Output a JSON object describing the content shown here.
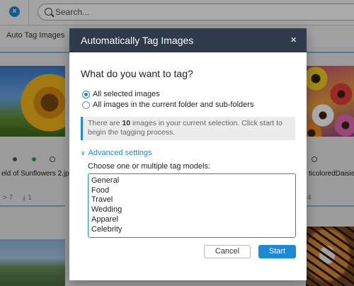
{
  "app": {
    "search_placeholder": "Search...",
    "toolbar_label": "Auto Tag Images",
    "file_left": "eld of Sunflowers 2.jpg",
    "file_right": "ticoloredDaisies",
    "meta_left_views": "7",
    "meta_left_downloads": "1",
    "meta_right_views": "4"
  },
  "dialog": {
    "title": "Automatically Tag Images",
    "close_glyph": "×",
    "question": "What do you want to tag?",
    "options": [
      {
        "label": "All selected images",
        "checked": true
      },
      {
        "label": "All images in the current folder and sub-folders",
        "checked": false
      }
    ],
    "info": {
      "prefix": "There are ",
      "count": "10",
      "suffix": " images in your current selection. Click start to begin the tagging process."
    },
    "advanced_label": "Advanced settings",
    "models_label": "Choose one or multiple tag models:",
    "models": [
      "General",
      "Food",
      "Travel",
      "Wedding",
      "Apparel",
      "Celebrity"
    ],
    "cancel_label": "Cancel",
    "start_label": "Start"
  },
  "colors": {
    "accent": "#1e88d6",
    "header": "#2f3a4b"
  },
  "icons": [
    "close-circle-icon",
    "search-icon",
    "close-icon",
    "chevron-down-icon",
    "radio-icon"
  ]
}
